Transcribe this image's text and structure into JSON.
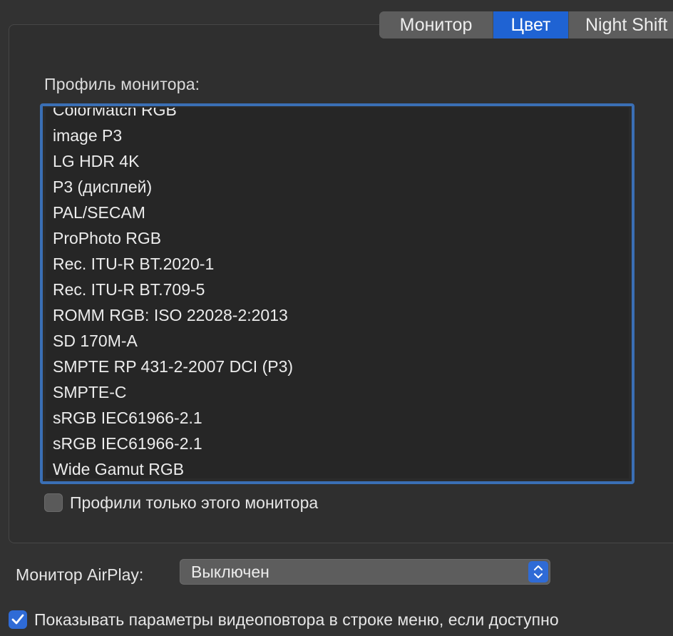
{
  "tabs": [
    {
      "label": "Монитор",
      "active": false
    },
    {
      "label": "Цвет",
      "active": true
    },
    {
      "label": "Night Shift",
      "active": false
    }
  ],
  "profile_section": {
    "label": "Профиль монитора:",
    "items": [
      "ColorMatch RGB",
      "image P3",
      "LG HDR 4K",
      "P3 (дисплей)",
      "PAL/SECAM",
      "ProPhoto RGB",
      "Rec. ITU-R BT.2020-1",
      "Rec. ITU-R BT.709-5",
      "ROMM RGB: ISO 22028-2:2013",
      "SD 170M-A",
      "SMPTE RP 431-2-2007 DCI (P3)",
      "SMPTE-C",
      "sRGB IEC61966-2.1",
      "sRGB IEC61966-2.1",
      "Wide Gamut RGB"
    ],
    "only_this_monitor_label": "Профили только этого монитора",
    "only_this_monitor_checked": false
  },
  "airplay": {
    "label": "Монитор AirPlay:",
    "value": "Выключен"
  },
  "mirroring_option": {
    "label": "Показывать параметры видеоповтора в строке меню, если доступно",
    "checked": true
  },
  "colors": {
    "accent": "#1f63d3",
    "focus_ring": "#3a6fb5",
    "background": "#323232"
  }
}
